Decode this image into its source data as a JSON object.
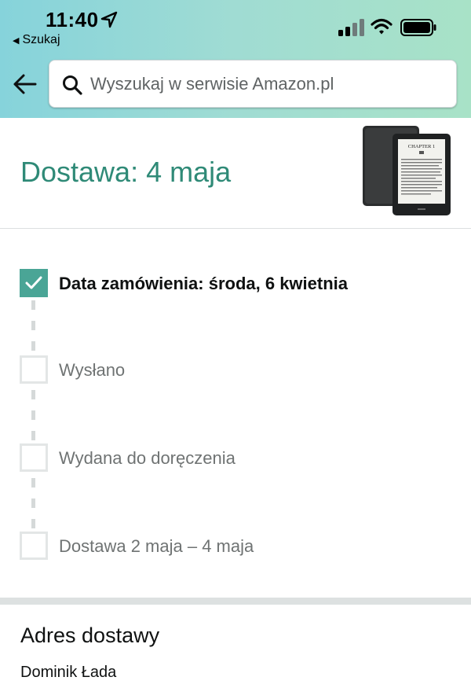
{
  "status_bar": {
    "time": "11:40",
    "back_app_label": "Szukaj",
    "icons": [
      "location-arrow-icon",
      "signal-icon",
      "wifi-icon",
      "battery-icon"
    ]
  },
  "nav": {
    "back_icon": "arrow-left-icon",
    "search": {
      "placeholder": "Wyszukaj w serwisie Amazon.pl",
      "icon": "search-icon"
    }
  },
  "delivery": {
    "title": "Dostawa: 4 maja",
    "product_image": "kindle-paperwhite-image"
  },
  "tracker": {
    "steps": [
      {
        "label": "Data zamówienia: środa, 6 kwietnia",
        "done": true
      },
      {
        "label": "Wysłano",
        "done": false
      },
      {
        "label": "Wydana do doręczenia",
        "done": false
      },
      {
        "label": "Dostawa 2 maja – 4 maja",
        "done": false
      }
    ]
  },
  "address": {
    "title": "Adres dostawy",
    "name": "Dominik Łada"
  },
  "colors": {
    "accent": "#2f8a77",
    "check_bg": "#4aa596",
    "header_gradient_start": "#86d3db",
    "header_gradient_end": "#a8e2c7"
  }
}
